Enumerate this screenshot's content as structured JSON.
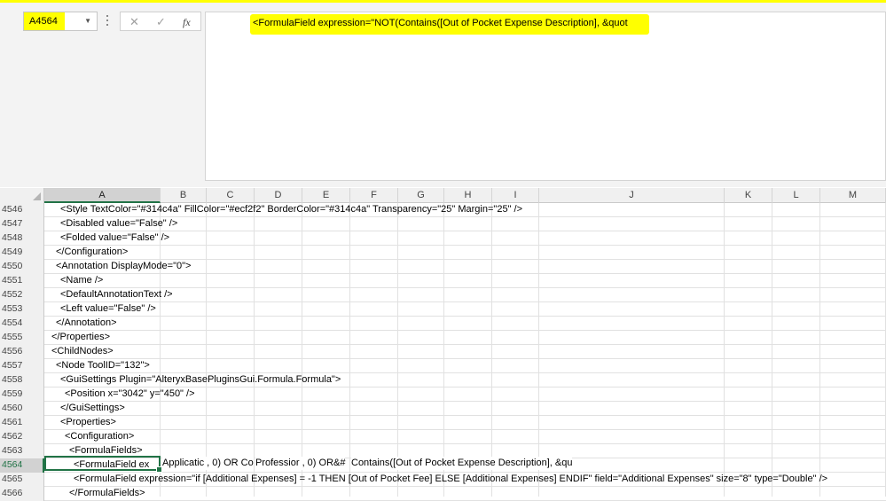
{
  "name_box": {
    "value": "A4564"
  },
  "formula_bar": {
    "cancel_symbol": "✕",
    "enter_symbol": "✓",
    "fx_label": "fx",
    "content": "<FormulaField expression=\"NOT(Contains([Out of Pocket Expense Description], &quot"
  },
  "columns": [
    "A",
    "B",
    "C",
    "D",
    "E",
    "F",
    "G",
    "H",
    "I",
    "J",
    "K",
    "L",
    "M"
  ],
  "selected_column": "A",
  "rows": [
    {
      "num": "4546",
      "indent": 2,
      "text": "<Style TextColor=\"#314c4a\" FillColor=\"#ecf2f2\" BorderColor=\"#314c4a\" Transparency=\"25\" Margin=\"25\" />"
    },
    {
      "num": "4547",
      "indent": 2,
      "text": "<Disabled value=\"False\" />"
    },
    {
      "num": "4548",
      "indent": 2,
      "text": "<Folded value=\"False\" />"
    },
    {
      "num": "4549",
      "indent": 1,
      "text": "</Configuration>"
    },
    {
      "num": "4550",
      "indent": 1,
      "text": "<Annotation DisplayMode=\"0\">"
    },
    {
      "num": "4551",
      "indent": 2,
      "text": "<Name />"
    },
    {
      "num": "4552",
      "indent": 2,
      "text": "<DefaultAnnotationText />"
    },
    {
      "num": "4553",
      "indent": 2,
      "text": "<Left value=\"False\" />"
    },
    {
      "num": "4554",
      "indent": 1,
      "text": "</Annotation>"
    },
    {
      "num": "4555",
      "indent": 0,
      "text": "</Properties>"
    },
    {
      "num": "4556",
      "indent": 0,
      "text": "<ChildNodes>"
    },
    {
      "num": "4557",
      "indent": 1,
      "text": "<Node ToolID=\"132\">"
    },
    {
      "num": "4558",
      "indent": 2,
      "text": "<GuiSettings Plugin=\"AlteryxBasePluginsGui.Formula.Formula\">"
    },
    {
      "num": "4559",
      "indent": 3,
      "text": "<Position x=\"3042\" y=\"450\" />"
    },
    {
      "num": "4560",
      "indent": 2,
      "text": "</GuiSettings>"
    },
    {
      "num": "4561",
      "indent": 2,
      "text": "<Properties>"
    },
    {
      "num": "4562",
      "indent": 3,
      "text": "<Configuration>"
    },
    {
      "num": "4563",
      "indent": 4,
      "text": "<FormulaFields>"
    },
    {
      "num": "4564",
      "indent": 5,
      "text": "<FormulaField ex"
    },
    {
      "num": "4565",
      "indent": 5,
      "text": "<FormulaField expression=\"if [Additional Expenses] = -1 THEN [Out of Pocket Fee] ELSE [Additional Expenses] ENDIF\" field=\"Additional Expenses\" size=\"8\" type=\"Double\" />"
    },
    {
      "num": "4566",
      "indent": 4,
      "text": "</FormulaFields>"
    }
  ],
  "selected_row": "4564",
  "overflow_cells": [
    {
      "text": "Applicatic , 0) OR Co"
    },
    {
      "text": "Professior , 0) OR&#"
    },
    {
      "text": "Contains([Out of Pocket Expense Description], &qu"
    }
  ]
}
